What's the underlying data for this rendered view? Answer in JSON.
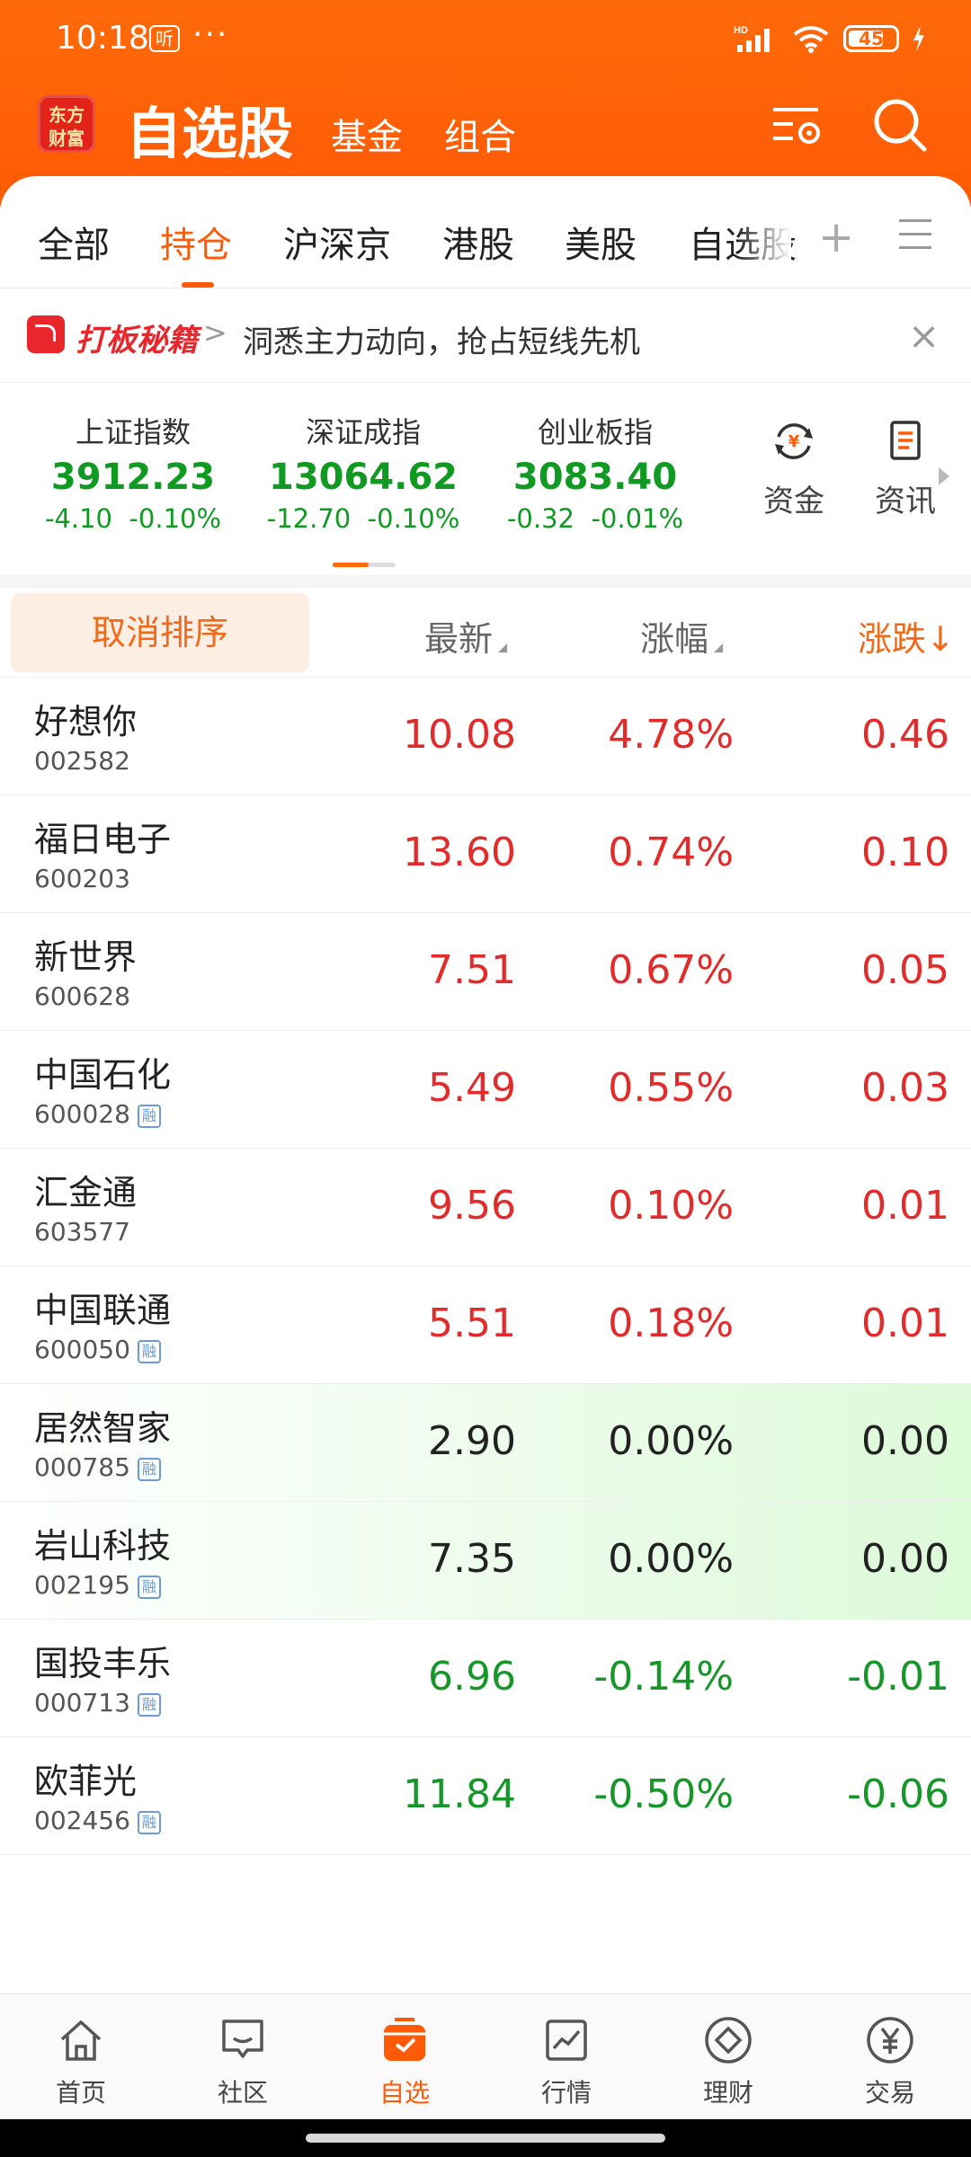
{
  "status_bar": {
    "time": "10:18",
    "listen_badge": "听",
    "more_dots": "···",
    "network": "HD",
    "battery": "45"
  },
  "header": {
    "logo_text": "东方财富",
    "title": "自选股",
    "tab_fund": "基金",
    "tab_portfolio": "组合"
  },
  "tabs": [
    "全部",
    "持仓",
    "沪深京",
    "港股",
    "美股",
    "自选股"
  ],
  "tabs_plus": "+",
  "promo": {
    "brand": "打板秘籍",
    "chevron": ">",
    "text": "洞悉主力动向，抢占短线先机",
    "close": "×"
  },
  "indices": [
    {
      "name": "上证指数",
      "value": "3912.23",
      "change": "-4.10",
      "pct": "-0.10%"
    },
    {
      "name": "深证成指",
      "value": "13064.62",
      "change": "-12.70",
      "pct": "-0.10%"
    },
    {
      "name": "创业板指",
      "value": "3083.40",
      "change": "-0.32",
      "pct": "-0.01%"
    }
  ],
  "quick_links": {
    "funds": "资金",
    "news": "资讯"
  },
  "table_header": {
    "cancel_sort": "取消排序",
    "latest": "最新",
    "pct_change": "涨幅",
    "change": "涨跌",
    "sort_arrow": "↓"
  },
  "rong_badge": "融",
  "stocks": [
    {
      "name": "好想你",
      "code": "002582",
      "price": "10.08",
      "pct": "4.78%",
      "change": "0.46",
      "trend": "up",
      "rong": false
    },
    {
      "name": "福日电子",
      "code": "600203",
      "price": "13.60",
      "pct": "0.74%",
      "change": "0.10",
      "trend": "up",
      "rong": false
    },
    {
      "name": "新世界",
      "code": "600628",
      "price": "7.51",
      "pct": "0.67%",
      "change": "0.05",
      "trend": "up",
      "rong": false
    },
    {
      "name": "中国石化",
      "code": "600028",
      "price": "5.49",
      "pct": "0.55%",
      "change": "0.03",
      "trend": "up",
      "rong": true
    },
    {
      "name": "汇金通",
      "code": "603577",
      "price": "9.56",
      "pct": "0.10%",
      "change": "0.01",
      "trend": "up",
      "rong": false
    },
    {
      "name": "中国联通",
      "code": "600050",
      "price": "5.51",
      "pct": "0.18%",
      "change": "0.01",
      "trend": "up",
      "rong": true
    },
    {
      "name": "居然智家",
      "code": "000785",
      "price": "2.90",
      "pct": "0.00%",
      "change": "0.00",
      "trend": "flat",
      "rong": true
    },
    {
      "name": "岩山科技",
      "code": "002195",
      "price": "7.35",
      "pct": "0.00%",
      "change": "0.00",
      "trend": "flat",
      "rong": true
    },
    {
      "name": "国投丰乐",
      "code": "000713",
      "price": "6.96",
      "pct": "-0.14%",
      "change": "-0.01",
      "trend": "down",
      "rong": true
    },
    {
      "name": "欧菲光",
      "code": "002456",
      "price": "11.84",
      "pct": "-0.50%",
      "change": "-0.06",
      "trend": "down",
      "rong": true
    }
  ],
  "bottom_nav": [
    "首页",
    "社区",
    "自选",
    "行情",
    "理财",
    "交易"
  ],
  "colors": {
    "brand": "#ff5a06",
    "up": "#e22b2b",
    "down": "#17962a"
  }
}
